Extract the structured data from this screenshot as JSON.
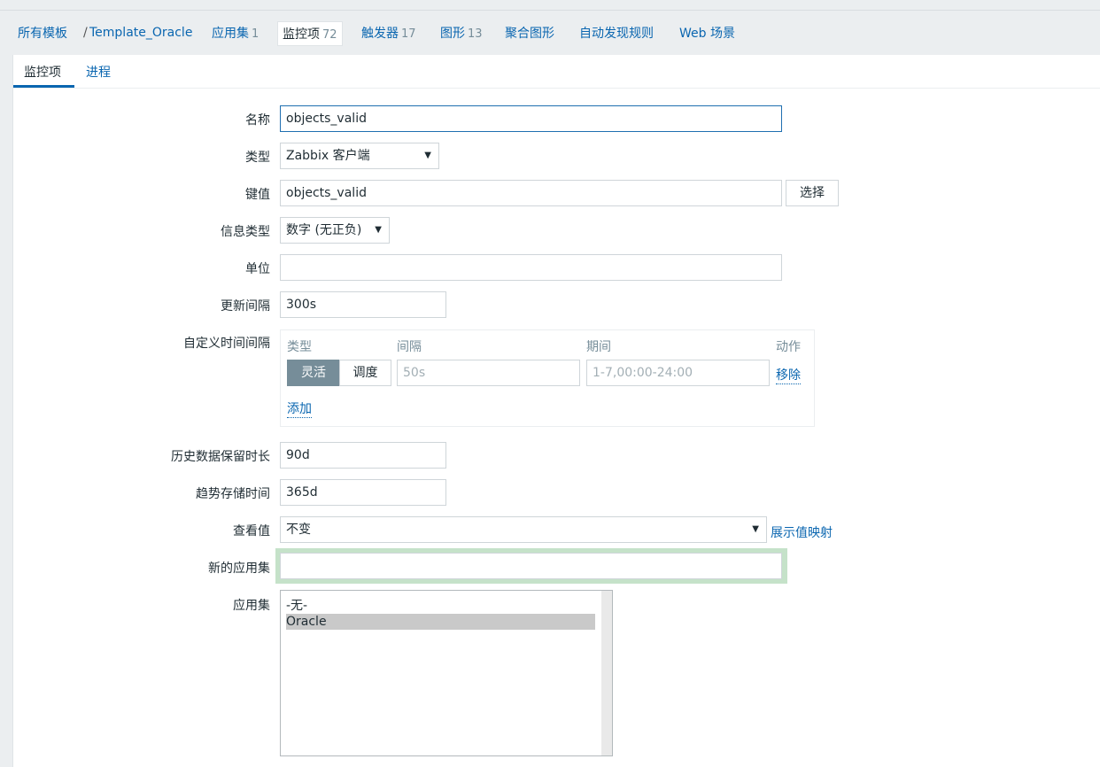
{
  "breadcrumb": {
    "all_templates": "所有模板",
    "separator": "/",
    "template_name": "Template_Oracle"
  },
  "nav": [
    {
      "label": "应用集",
      "count": "1"
    },
    {
      "label": "监控项",
      "count": "72"
    },
    {
      "label": "触发器",
      "count": "17"
    },
    {
      "label": "图形",
      "count": "13"
    },
    {
      "label": "聚合图形",
      "count": ""
    },
    {
      "label": "自动发现规则",
      "count": ""
    },
    {
      "label": "Web 场景",
      "count": ""
    }
  ],
  "tabs": [
    "监控项",
    "进程"
  ],
  "form": {
    "name_label": "名称",
    "name_value": "objects_valid",
    "type_label": "类型",
    "type_value": "Zabbix 客户端",
    "key_label": "键值",
    "key_value": "objects_valid",
    "select_button": "选择",
    "info_type_label": "信息类型",
    "info_type_value": "数字 (无正负)",
    "units_label": "单位",
    "units_value": "",
    "update_interval_label": "更新间隔",
    "update_interval_value": "300s",
    "custom_intervals_label": "自定义时间间隔",
    "custom_intervals": {
      "col_type": "类型",
      "col_interval": "间隔",
      "col_period": "期间",
      "col_action": "动作",
      "toggle_flexible": "灵活",
      "toggle_scheduling": "调度",
      "interval_placeholder": "50s",
      "period_placeholder": "1-7,00:00-24:00",
      "remove_link": "移除",
      "add_link": "添加"
    },
    "history_label": "历史数据保留时长",
    "history_value": "90d",
    "trends_label": "趋势存储时间",
    "trends_value": "365d",
    "show_value_label": "查看值",
    "show_value_value": "不变",
    "show_value_mapping_link": "展示值映射",
    "new_application_label": "新的应用集",
    "new_application_value": "",
    "applications_label": "应用集",
    "applications_options": [
      "-无-",
      "Oracle"
    ]
  },
  "colors": {
    "link": "#0a66b0",
    "toggle_active": "#768d99",
    "focus_glow": "#c5e2c9"
  }
}
